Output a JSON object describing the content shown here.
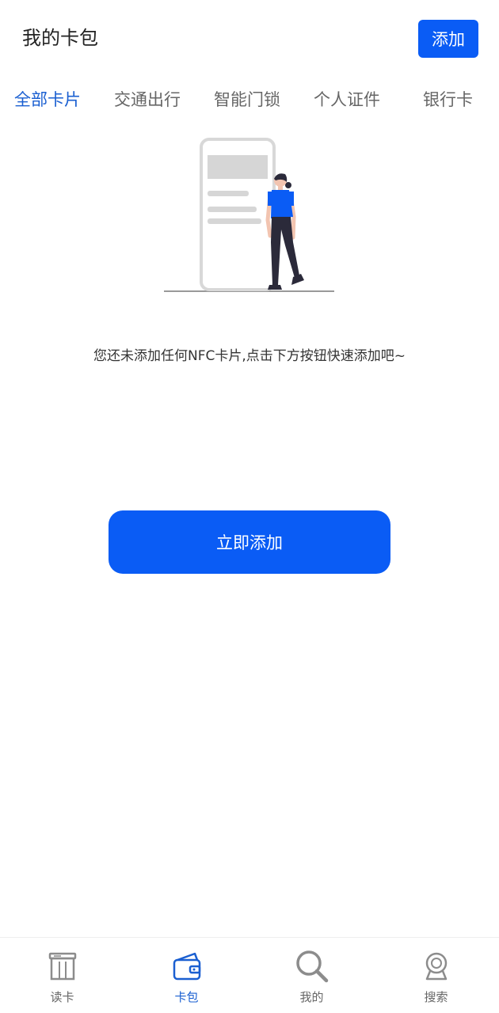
{
  "header": {
    "title": "我的卡包",
    "add_label": "添加"
  },
  "tabs": [
    {
      "label": "全部卡片",
      "active": true
    },
    {
      "label": "交通出行",
      "active": false
    },
    {
      "label": "智能门锁",
      "active": false
    },
    {
      "label": "个人证件",
      "active": false
    },
    {
      "label": "银行卡",
      "active": false
    }
  ],
  "empty_state": {
    "message": "您还未添加任何NFC卡片,点击下方按钮快速添加吧~",
    "button_label": "立即添加"
  },
  "bottom_nav": [
    {
      "label": "读卡",
      "icon": "card-reader-icon",
      "active": false
    },
    {
      "label": "卡包",
      "icon": "wallet-icon",
      "active": true
    },
    {
      "label": "我的",
      "icon": "search-icon",
      "active": false
    },
    {
      "label": "搜索",
      "icon": "webcam-icon",
      "active": false
    }
  ],
  "colors": {
    "accent": "#0a5cf5",
    "active_tab": "#1a5fd1",
    "inactive_text": "#666666"
  }
}
